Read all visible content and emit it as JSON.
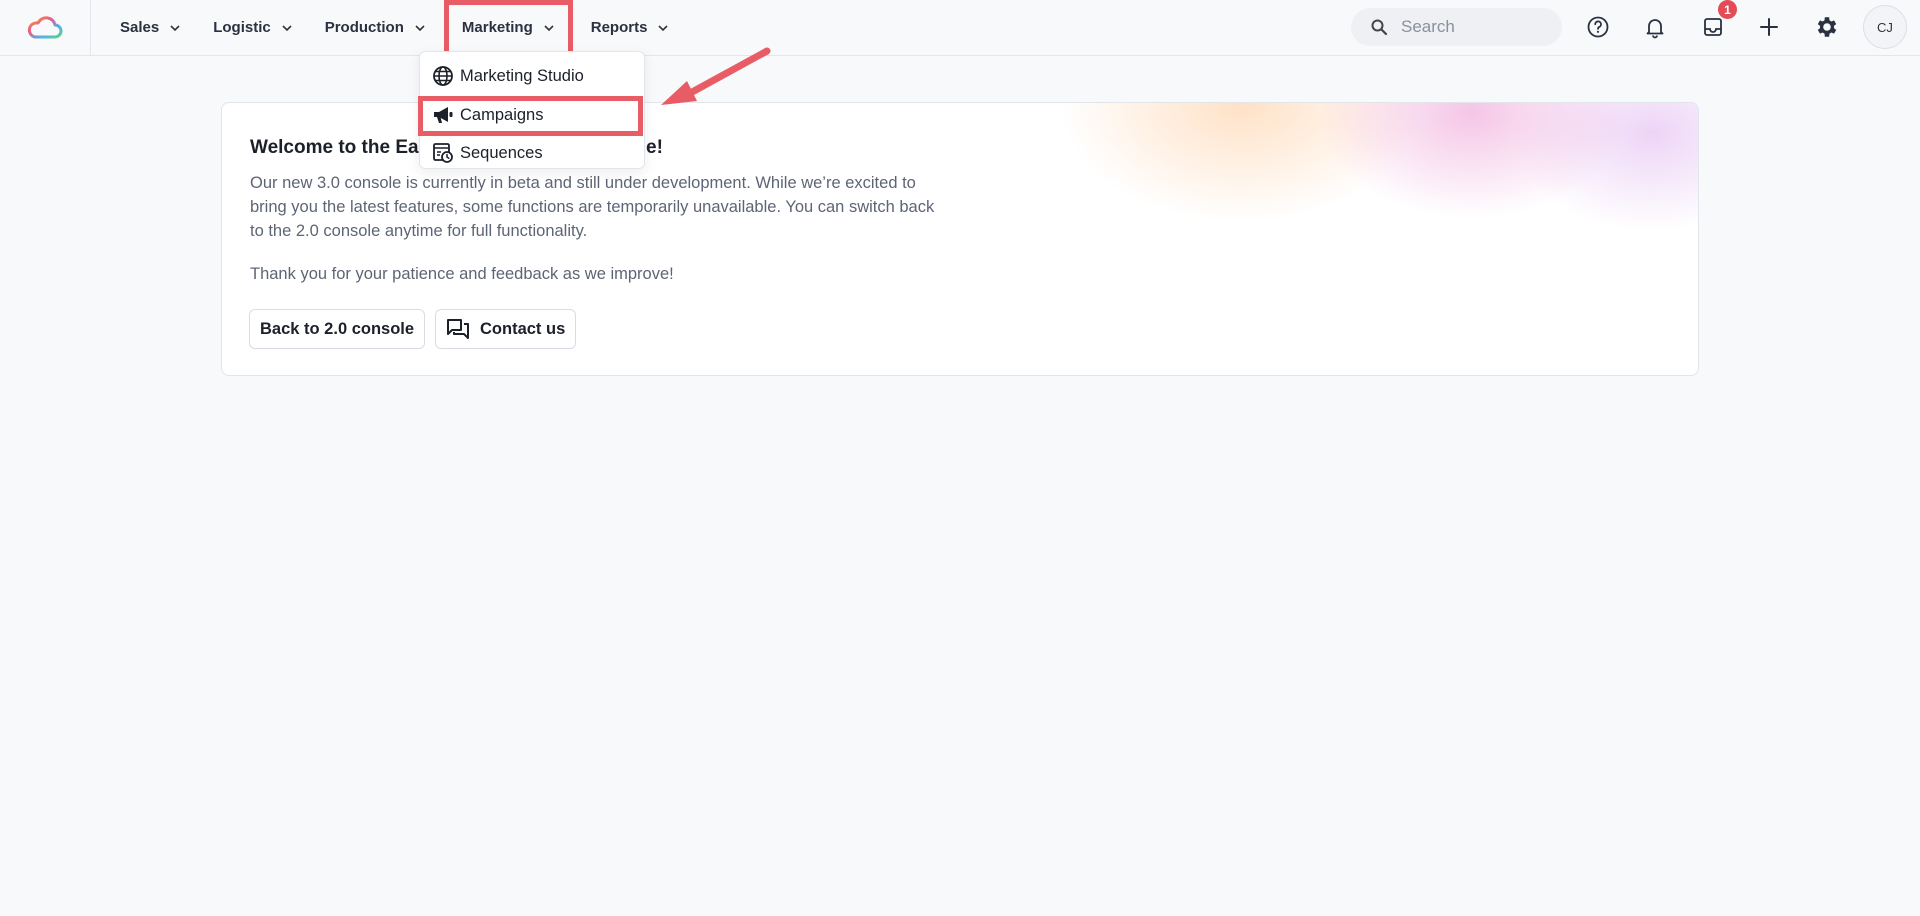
{
  "nav": {
    "items": [
      {
        "label": "Sales"
      },
      {
        "label": "Logistic"
      },
      {
        "label": "Production"
      },
      {
        "label": "Marketing"
      },
      {
        "label": "Reports"
      }
    ]
  },
  "search": {
    "placeholder": "Search"
  },
  "notifications": {
    "inbox_badge": "1"
  },
  "user": {
    "initials": "CJ"
  },
  "marketing_menu": {
    "items": [
      {
        "label": "Marketing Studio",
        "icon": "globe-icon"
      },
      {
        "label": "Campaigns",
        "icon": "megaphone-icon"
      },
      {
        "label": "Sequences",
        "icon": "sequence-calendar-icon"
      }
    ]
  },
  "welcome": {
    "title_start": "Welcome to the Eas",
    "title_end": "ole!",
    "body": "Our new 3.0 console is currently in beta and still under development. While we’re excited to bring you the latest features, some functions are temporarily unavailable. You can switch back to the 2.0 console anytime for full functionality.",
    "thanks": "Thank you for your patience and feedback as we improve!",
    "back_button": "Back to 2.0 console",
    "contact_button": "Contact us"
  },
  "annotation_color": "#e85d65"
}
